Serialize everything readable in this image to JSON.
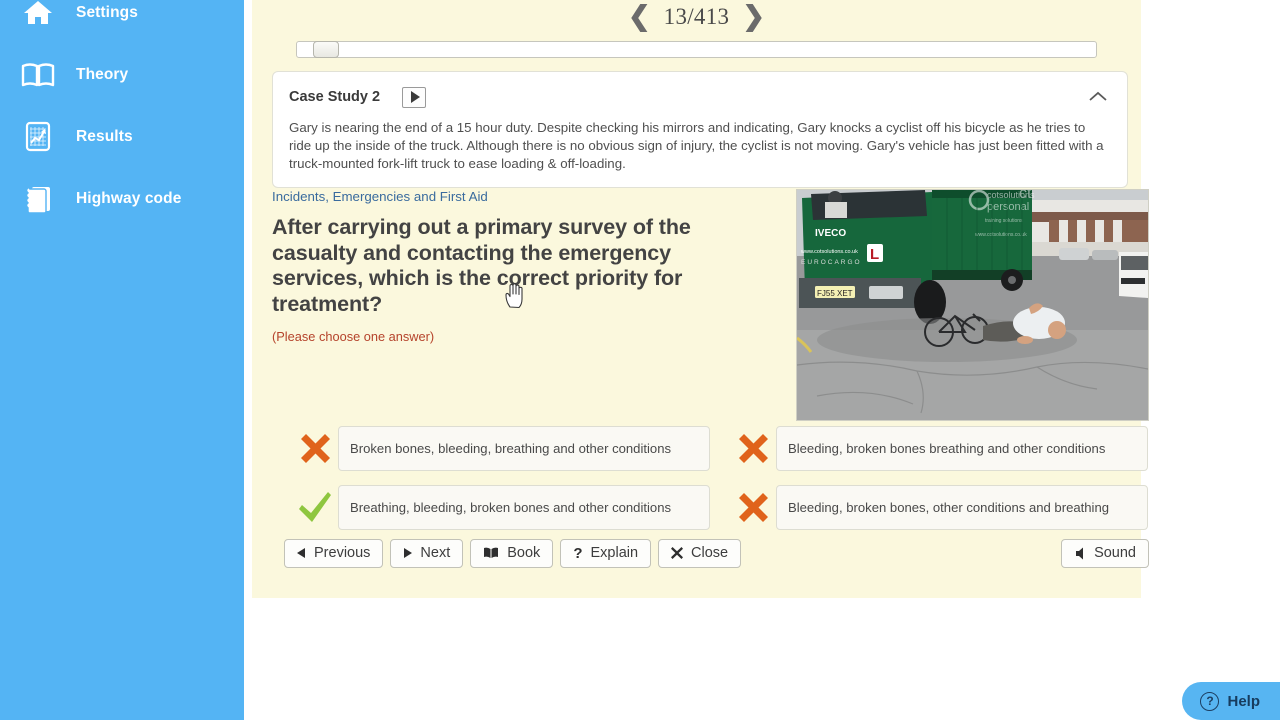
{
  "sidebar": {
    "items": [
      {
        "id": "settings",
        "label": "Settings",
        "icon": "home-icon"
      },
      {
        "id": "theory",
        "label": "Theory",
        "icon": "book-open-icon"
      },
      {
        "id": "results",
        "label": "Results",
        "icon": "results-chart-icon"
      },
      {
        "id": "highway-code",
        "label": "Highway code",
        "icon": "notebook-icon"
      }
    ],
    "background_color": "#54b4f4"
  },
  "pager": {
    "prev_glyph": "❮",
    "next_glyph": "❯",
    "counter": "13/413",
    "current": 13,
    "total": 413
  },
  "scrollbar": {
    "name": "horizontal-scrollbar",
    "thumb_position_percent": 2
  },
  "case_study": {
    "title": "Case Study 2",
    "play_label": "play",
    "collapse_label": "collapse",
    "body": "Gary is nearing the end of a 15 hour duty. Despite checking his mirrors and indicating, Gary knocks a cyclist off his bicycle as he tries to ride up the inside of the truck. Although there is no obvious sign of injury, the cyclist is not moving. Gary's vehicle has just been fitted with a truck-mounted fork-lift truck to ease loading & off-loading."
  },
  "question": {
    "category": "Incidents, Emergencies and First Aid",
    "text": "After carrying out a primary survey of the casualty and contacting the emergency services, which is the correct priority for treatment?",
    "hint": "(Please choose one answer)",
    "hint_color": "#b5432b",
    "category_color": "#3a6b9e"
  },
  "photo": {
    "alt": "Green IVECO truck with cyclist lying on the road beside a fallen bicycle",
    "truck_brand": "IVECO",
    "truck_model": "EUROCARGO",
    "plate": "FJ55 XET",
    "website": "www.cotsolutions.co.uk",
    "learner_plate": "L"
  },
  "answers": [
    {
      "id": "a",
      "text": "Broken bones, bleeding, breathing and other conditions",
      "mark": "cross",
      "correct": false
    },
    {
      "id": "b",
      "text": "Bleeding, broken bones breathing and other conditions",
      "mark": "cross",
      "correct": false
    },
    {
      "id": "c",
      "text": "Breathing, bleeding, broken bones and other conditions",
      "mark": "tick",
      "correct": true
    },
    {
      "id": "d",
      "text": "Bleeding, broken bones, other conditions and breathing",
      "mark": "cross",
      "correct": false
    }
  ],
  "toolbar": {
    "buttons": [
      {
        "id": "previous",
        "label": "Previous",
        "icon": "triangle-left-icon"
      },
      {
        "id": "next",
        "label": "Next",
        "icon": "triangle-right-icon"
      },
      {
        "id": "book",
        "label": "Book",
        "icon": "book-icon"
      },
      {
        "id": "explain",
        "label": "Explain",
        "icon": "question-mark-icon"
      },
      {
        "id": "close",
        "label": "Close",
        "icon": "x-icon"
      }
    ],
    "sound": {
      "id": "sound",
      "label": "Sound",
      "icon": "speaker-icon"
    }
  },
  "help": {
    "label": "Help",
    "icon": "question-circle-icon",
    "color": "#57b5f2"
  },
  "colors": {
    "panel_background": "#fbf8dd",
    "page_background": "#ffffff",
    "cross_mark": "#e0631b",
    "tick_mark": "#8ec63f"
  }
}
